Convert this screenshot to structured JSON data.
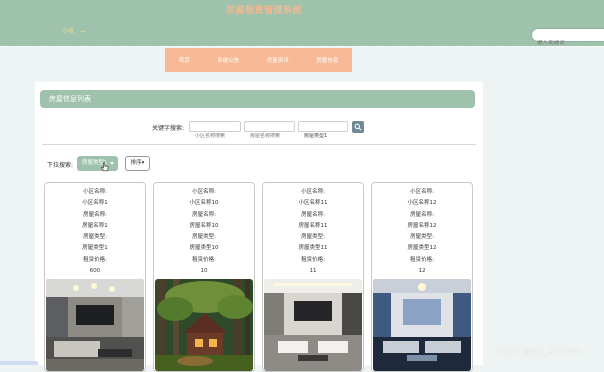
{
  "header": {
    "title": "房屋租赁管理系统",
    "user_label": "小张",
    "search_placeholder": "输入关键词"
  },
  "nav": {
    "items": [
      "首页",
      "系统公告",
      "房屋资讯",
      "房屋信息"
    ]
  },
  "page": {
    "section_title": "房屋信息列表"
  },
  "search": {
    "label": "关键字搜索:",
    "fields": [
      {
        "placeholder": "小区名称搜索"
      },
      {
        "placeholder": "房屋名称搜索"
      },
      {
        "value": "房屋类型1"
      }
    ]
  },
  "filter": {
    "label": "下拉搜索:",
    "type_selected": "房屋类型1",
    "sort_label": "排序▾"
  },
  "cards": [
    {
      "community_label": "小区名称:",
      "community": "小区名称1",
      "house_label": "房屋名称:",
      "house": "房屋名称1",
      "type_label": "房屋类型:",
      "type": "房屋类型1",
      "price_label": "租赁价格:",
      "price": "600",
      "image": "living-room"
    },
    {
      "community_label": "小区名称:",
      "community": "小区名称10",
      "house_label": "房屋名称:",
      "house": "房屋名称10",
      "type_label": "房屋类型:",
      "type": "房屋类型10",
      "price_label": "租赁价格:",
      "price": "10",
      "image": "forest-cabin"
    },
    {
      "community_label": "小区名称:",
      "community": "小区名称11",
      "house_label": "房屋名称:",
      "house": "房屋名称11",
      "type_label": "房屋类型:",
      "type": "房屋类型11",
      "price_label": "租赁价格:",
      "price": "11",
      "image": "modern-living-room"
    },
    {
      "community_label": "小区名称:",
      "community": "小区名称12",
      "house_label": "房屋名称:",
      "house": "房屋名称12",
      "type_label": "房屋类型:",
      "type": "房屋类型12",
      "price_label": "租赁价格:",
      "price": "12",
      "image": "blue-living-room"
    }
  ],
  "watermark": "CSDN @MZ_ZXD001",
  "colors": {
    "header": "#9fc2ad",
    "nav": "#f7b996",
    "title_text": "#f4b891",
    "user_text": "#f3e08f"
  }
}
